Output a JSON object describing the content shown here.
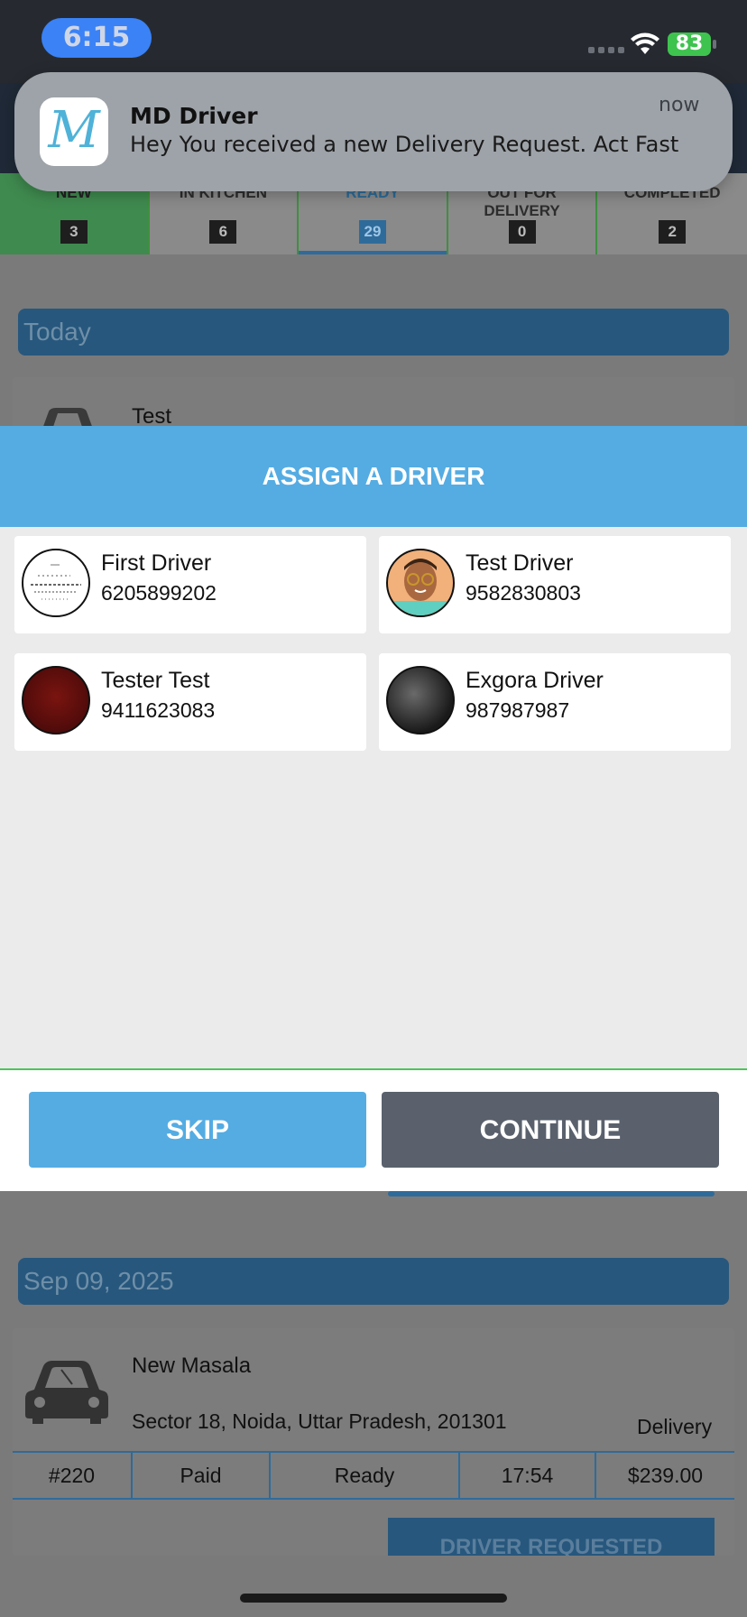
{
  "status_bar": {
    "time": "6:15",
    "battery": "83"
  },
  "notification": {
    "app_name": "MD Driver",
    "message": "Hey You received a new Delivery Request. Act Fast",
    "time": "now",
    "icon_letter": "M"
  },
  "tabs": [
    {
      "label": "NEW",
      "count": "3"
    },
    {
      "label": "IN KITCHEN",
      "count": "6"
    },
    {
      "label": "READY",
      "count": "29"
    },
    {
      "label": "OUT FOR DELIVERY",
      "count": "0"
    },
    {
      "label": "COMPLETED",
      "count": "2"
    }
  ],
  "sections": [
    {
      "date": "Today",
      "first_order_name": "Test"
    },
    {
      "date": "Sep 09, 2025"
    }
  ],
  "order": {
    "name": "New Masala",
    "address": "Sector 18, Noida, Uttar Pradesh, 201301",
    "type": "Delivery",
    "number": "#220",
    "payment": "Paid",
    "status": "Ready",
    "time": "17:54",
    "total": "$239.00",
    "action_label": "DRIVER REQUESTED"
  },
  "modal": {
    "title": "ASSIGN A DRIVER",
    "drivers": [
      {
        "name": "First Driver",
        "phone": "6205899202"
      },
      {
        "name": "Test Driver",
        "phone": "9582830803"
      },
      {
        "name": "Tester Test",
        "phone": "9411623083"
      },
      {
        "name": "Exgora Driver",
        "phone": "987987987"
      }
    ],
    "skip_label": "SKIP",
    "continue_label": "CONTINUE"
  },
  "colors": {
    "accent_blue": "#54ace3",
    "continue_gray": "#5a616d",
    "new_tab_green": "#3f8a4f"
  }
}
